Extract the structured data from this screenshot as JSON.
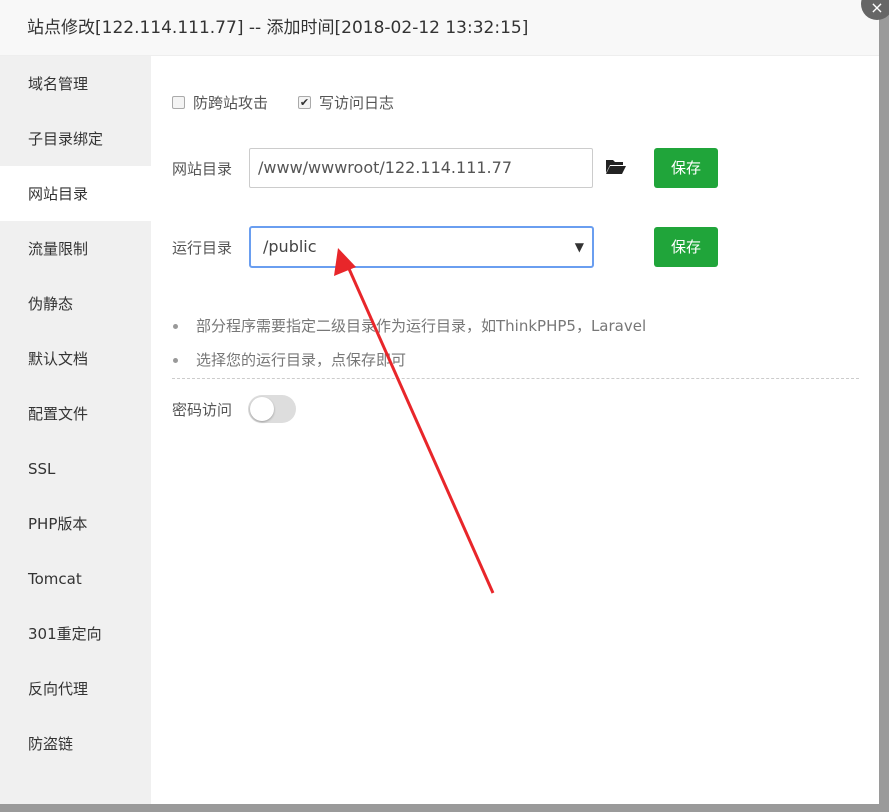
{
  "title": "站点修改[122.114.111.77] -- 添加时间[2018-02-12 13:32:15]",
  "close_icon": "×",
  "sidebar": {
    "items": [
      {
        "label": "域名管理"
      },
      {
        "label": "子目录绑定"
      },
      {
        "label": "网站目录",
        "active": true
      },
      {
        "label": "流量限制"
      },
      {
        "label": "伪静态"
      },
      {
        "label": "默认文档"
      },
      {
        "label": "配置文件"
      },
      {
        "label": "SSL"
      },
      {
        "label": "PHP版本"
      },
      {
        "label": "Tomcat"
      },
      {
        "label": "301重定向"
      },
      {
        "label": "反向代理"
      },
      {
        "label": "防盗链"
      }
    ]
  },
  "options": {
    "anti_xss": {
      "label": "防跨站攻击",
      "checked": false
    },
    "access_log": {
      "label": "写访问日志",
      "checked": true
    }
  },
  "site_dir": {
    "label": "网站目录",
    "value": "/www/wwwroot/122.114.111.77",
    "save": "保存"
  },
  "run_dir": {
    "label": "运行目录",
    "value": "/public",
    "save": "保存"
  },
  "tips": [
    "部分程序需要指定二级目录作为运行目录，如ThinkPHP5，Laravel",
    "选择您的运行目录，点保存即可"
  ],
  "password_access": {
    "label": "密码访问",
    "enabled": false
  },
  "colors": {
    "accent": "#20a53a",
    "focus": "#6a9ef0",
    "annotation": "#e8262a"
  }
}
